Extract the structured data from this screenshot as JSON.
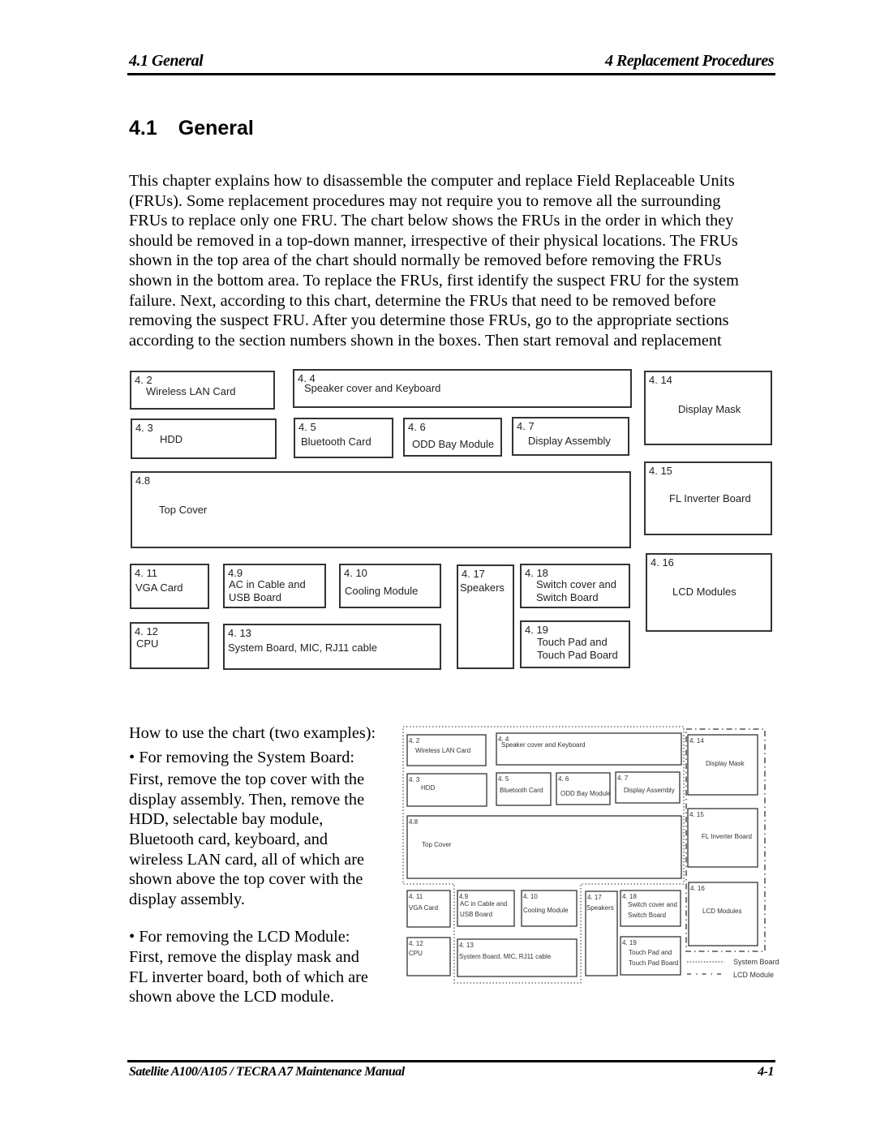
{
  "header": {
    "left": "4.1 General",
    "right": "4 Replacement Procedures"
  },
  "section": {
    "number": "4.1",
    "title": "General"
  },
  "intro_lines": [
    "This chapter explains how to disassemble the computer and replace Field Replaceable Units",
    "(FRUs). Some replacement procedures may not require you to remove all the surrounding",
    "FRUs to replace only one FRU. The chart below shows the FRUs in the order in which they",
    "should be removed in a top-down manner, irrespective of their physical locations.  The FRUs",
    "shown in the top area of the chart should normally be removed before removing the FRUs",
    "shown in the bottom area. To replace the FRUs, first identify the suspect FRU for the system",
    "failure. Next, according to this chart, determine the FRUs that need to be removed before",
    "removing the suspect FRU. After you determine those FRUs, go to the appropriate sections",
    "according to the section numbers shown in the boxes. Then start removal and replacement"
  ],
  "fru_chart": [
    {
      "num": "4. 2",
      "label": [
        "Wireless LAN Card"
      ]
    },
    {
      "num": "4. 4",
      "label": [
        "Speaker cover and  Keyboard"
      ]
    },
    {
      "num": "4. 14",
      "label": [
        "Display Mask"
      ]
    },
    {
      "num": "4. 3",
      "label": [
        "HDD"
      ]
    },
    {
      "num": "4. 5",
      "label": [
        "Bluetooth Card"
      ]
    },
    {
      "num": "4. 6",
      "label": [
        "ODD Bay Module"
      ]
    },
    {
      "num": "4. 7",
      "label": [
        "Display Assembly"
      ]
    },
    {
      "num": "4.8",
      "label": [
        "Top Cover"
      ]
    },
    {
      "num": "4. 15",
      "label": [
        "FL Inverter Board"
      ]
    },
    {
      "num": "4. 11",
      "label": [
        "VGA Card"
      ]
    },
    {
      "num": "4.9",
      "label": [
        "AC in Cable and",
        "USB Board"
      ]
    },
    {
      "num": "4. 10",
      "label": [
        "Cooling Module"
      ]
    },
    {
      "num": "4. 17",
      "label": [
        "Speakers"
      ]
    },
    {
      "num": "4. 18",
      "label": [
        "Switch cover and",
        "Switch Board"
      ]
    },
    {
      "num": "4. 16",
      "label": [
        "LCD Modules"
      ]
    },
    {
      "num": "4. 12",
      "label": [
        "CPU"
      ]
    },
    {
      "num": "4. 13",
      "label": [
        "System Board, MIC, RJ11 cable"
      ]
    },
    {
      "num": "4. 19",
      "label": [
        "Touch Pad and",
        "Touch Pad Board"
      ]
    }
  ],
  "howto": {
    "heading": "How to use the chart (two examples):",
    "example1_title": "For removing the System Board:",
    "example1_lines": [
      "First, remove the top cover with the",
      "display assembly. Then, remove the",
      "HDD, selectable bay module,",
      "Bluetooth card, keyboard, and",
      "wireless LAN card, all of which are",
      "shown above the top cover with the",
      "display assembly."
    ],
    "example2_title": "For removing the LCD Module:",
    "example2_lines": [
      "First, remove the display mask and",
      "FL inverter board, both of which are",
      "shown above the LCD module."
    ],
    "bullet": "•"
  },
  "legend": {
    "system_board": "System Board",
    "lcd_module": "LCD Module"
  },
  "footer": {
    "left": "Satellite A100/A105 / TECRA A7 Maintenance Manual",
    "right": "4-1"
  }
}
